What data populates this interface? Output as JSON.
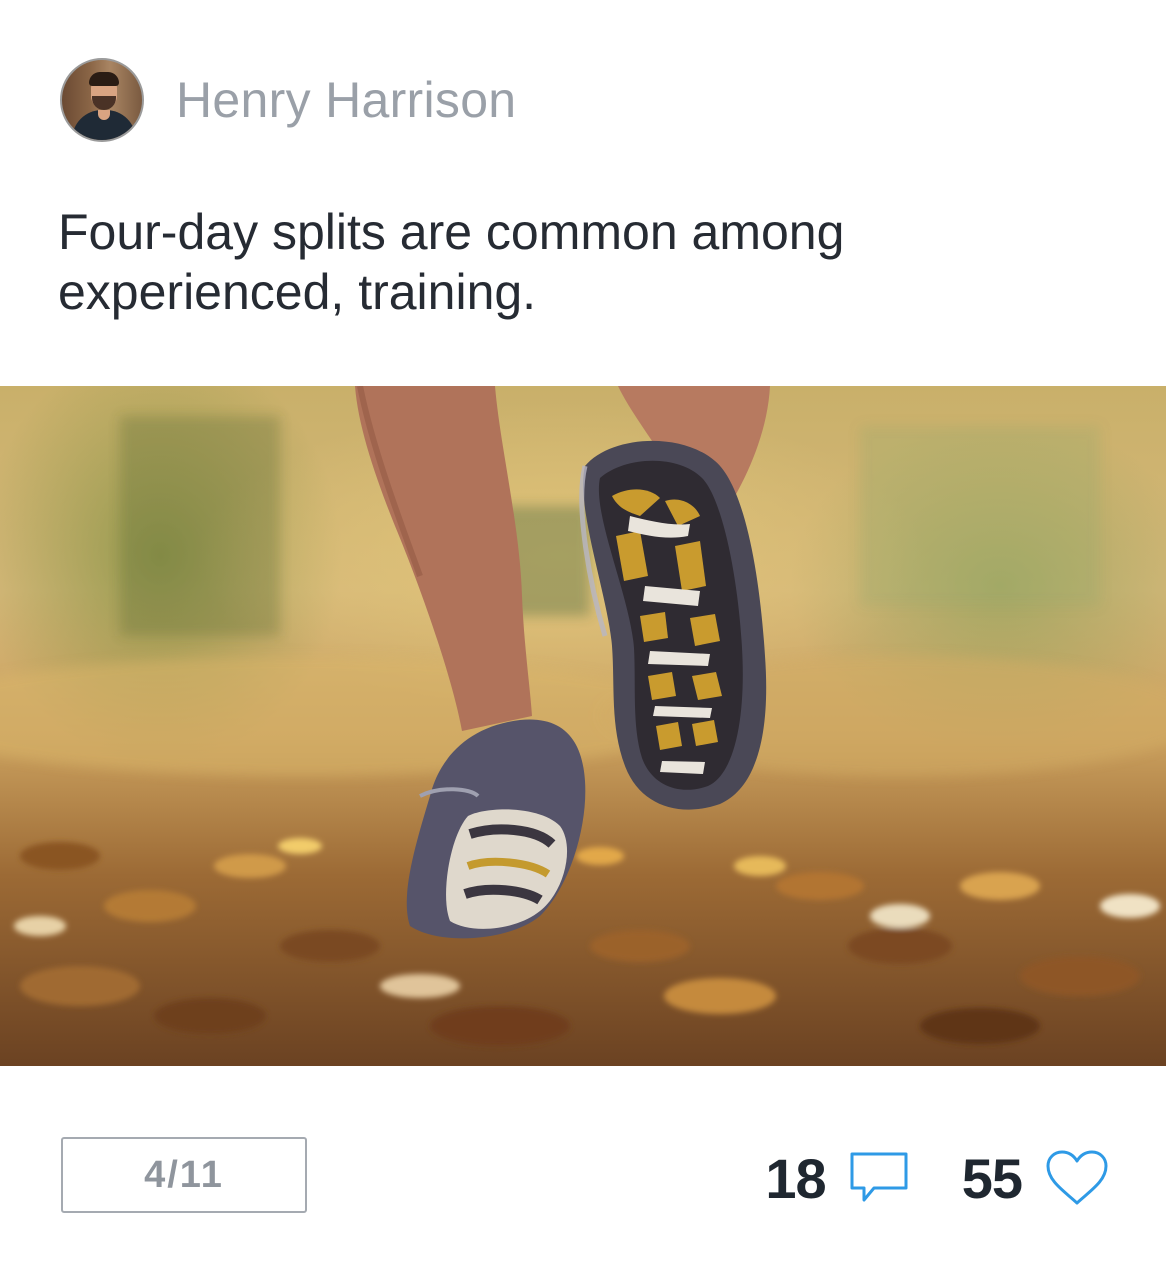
{
  "post": {
    "author": {
      "name": "Henry Harrison",
      "avatar_icon": "user-avatar-photo"
    },
    "caption": "Four-day splits are common among experienced, training.",
    "image": {
      "description_icon": "runner-photo"
    },
    "pager": {
      "text": "4/11"
    },
    "stats": {
      "comments": "18",
      "comments_icon": "speech-bubble-icon",
      "likes": "55",
      "likes_icon": "heart-icon"
    }
  },
  "colors": {
    "accent": "#2e9ae6",
    "text_primary": "#262b33",
    "text_muted": "#9aa0a8",
    "border": "#a5aab1"
  }
}
